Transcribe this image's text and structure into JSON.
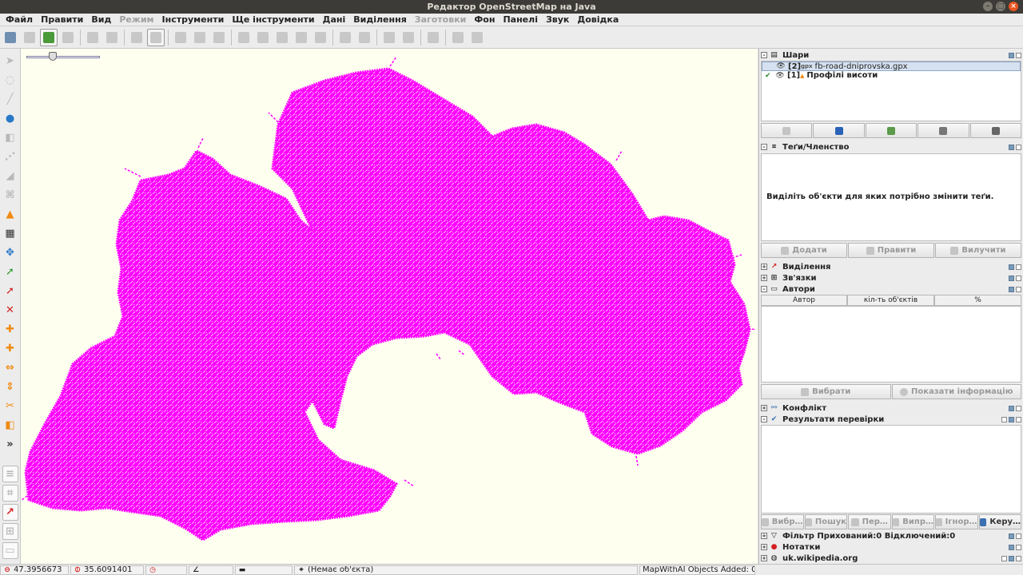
{
  "window": {
    "title": "Редактор OpenStreetMap на Java"
  },
  "menu": [
    {
      "label": "Файл",
      "enabled": true
    },
    {
      "label": "Правити",
      "enabled": true
    },
    {
      "label": "Вид",
      "enabled": true
    },
    {
      "label": "Режим",
      "enabled": false
    },
    {
      "label": "Інструменти",
      "enabled": true
    },
    {
      "label": "Ще інструменти",
      "enabled": true
    },
    {
      "label": "Дані",
      "enabled": true
    },
    {
      "label": "Виділення",
      "enabled": true
    },
    {
      "label": "Заготовки",
      "enabled": false
    },
    {
      "label": "Фон",
      "enabled": true
    },
    {
      "label": "Панелі",
      "enabled": true
    },
    {
      "label": "Звук",
      "enabled": true
    },
    {
      "label": "Довідка",
      "enabled": true
    }
  ],
  "map": {
    "data_color": "#ff00ff",
    "background": "#fffff0"
  },
  "layers_panel": {
    "title": "Шари",
    "layers": [
      {
        "index": "[2]",
        "kind": "gpx",
        "name": "fb-road-dniprovska.gpx",
        "selected": true,
        "active": false
      },
      {
        "index": "[1]",
        "kind": "",
        "name": "Профілі висоти",
        "selected": false,
        "active": true
      }
    ]
  },
  "tags_panel": {
    "title": "Теґи/Членство",
    "message": "Виділіть об'єкти для яких потрібно змінити теґи.",
    "buttons": {
      "add": "Додати",
      "edit": "Правити",
      "delete": "Вилучити"
    }
  },
  "collapsed_panels": {
    "selection": "Виділення",
    "relations": "Зв'язки"
  },
  "authors_panel": {
    "title": "Автори",
    "columns": [
      "Автор",
      "кіл-ть об'єктів",
      "%"
    ],
    "buttons": {
      "select": "Вибрати",
      "show_info": "Показати інформацію"
    }
  },
  "conflict_panel": {
    "title": "Конфлікт"
  },
  "validation_panel": {
    "title": "Результати перевірки",
    "buttons": [
      "Вибр…",
      "Пошук",
      "Пер…",
      "Випр…",
      "Ігнор…",
      "Керу…"
    ]
  },
  "filter_panel": {
    "title": "Фільтр Прихований:0 Відключений:0"
  },
  "notes_panel": {
    "title": "Нотатки"
  },
  "wiki_panel": {
    "title": "uk.wikipedia.org"
  },
  "status": {
    "lat": "47.3956673",
    "lon": "35.6091401",
    "object": "(Немає об'єкта)",
    "plugin": "MapWithAI Objects Added: 0"
  }
}
